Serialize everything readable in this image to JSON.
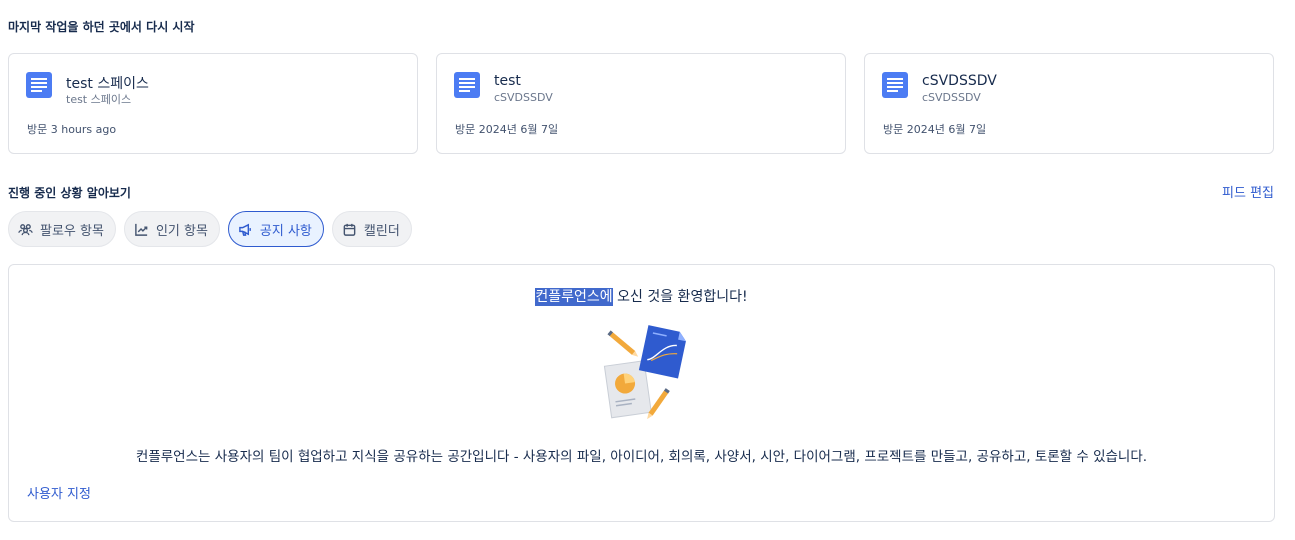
{
  "recent": {
    "title": "마지막 작업을 하던 곳에서 다시 시작",
    "cards": [
      {
        "title": "test 스페이스",
        "space": "test 스페이스",
        "visit": "방문 3 hours ago",
        "icon": "document-icon"
      },
      {
        "title": "test",
        "space": "cSVDSSDV",
        "visit": "방문 2024년 6월 7일",
        "icon": "document-icon"
      },
      {
        "title": "cSVDSSDV",
        "space": "cSVDSSDV",
        "visit": "방문 2024년 6월 7일",
        "icon": "document-icon"
      }
    ]
  },
  "feed": {
    "title": "진행 중인 상황 알아보기",
    "edit_label": "피드 편집",
    "tabs": [
      {
        "label": "팔로우 항목",
        "icon": "people-icon",
        "active": false
      },
      {
        "label": "인기 항목",
        "icon": "trend-icon",
        "active": false
      },
      {
        "label": "공지 사항",
        "icon": "megaphone-icon",
        "active": true
      },
      {
        "label": "캘린더",
        "icon": "calendar-icon",
        "active": false
      }
    ]
  },
  "announcement": {
    "welcome_highlight": "컨플루언스에",
    "welcome_rest": " 오신 것을 환영합니다!",
    "description": "컨플루언스는 사용자의 팀이 협업하고 지식을 공유하는 공간입니다 - 사용자의 파일, 아이디어, 회의록, 사양서, 시안, 다이어그램, 프로젝트를 만들고, 공유하고, 토론할 수 있습니다.",
    "customize_label": "사용자 지정",
    "illustration": "documents-illustration"
  },
  "colors": {
    "accent": "#2f5bcf",
    "doc_icon": "#4c7cf3",
    "highlight": "#4169cc",
    "border": "#dfe1e6"
  }
}
